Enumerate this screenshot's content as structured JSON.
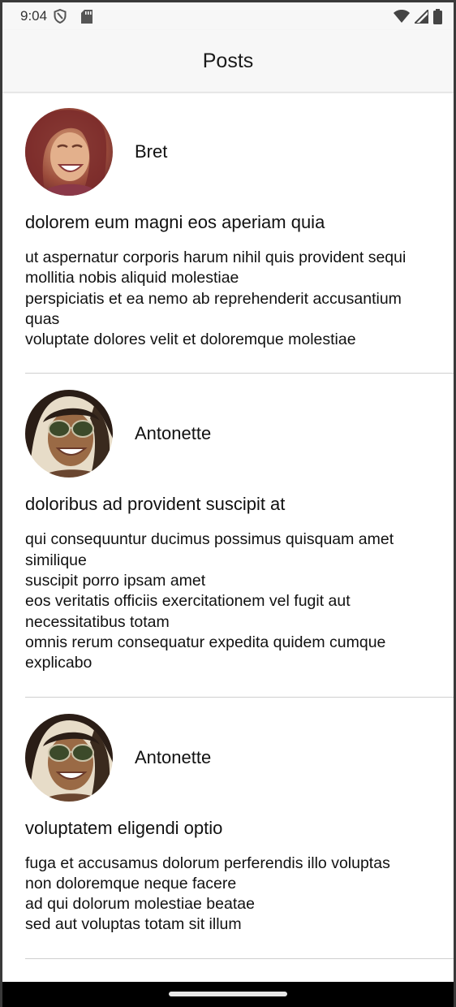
{
  "status_bar": {
    "time": "9:04",
    "icons": [
      "shield-icon",
      "sd-card-icon",
      "wifi-icon",
      "signal-icon",
      "battery-icon"
    ]
  },
  "app_bar": {
    "title": "Posts"
  },
  "posts": [
    {
      "author": "Bret",
      "avatar": "avatar-woman-laughing",
      "title": "dolorem eum magni eos aperiam quia",
      "body": "ut aspernatur corporis harum nihil quis provident sequi\nmollitia nobis aliquid molestiae\nperspiciatis et ea nemo ab reprehenderit accusantium quas\nvoluptate dolores velit et doloremque molestiae"
    },
    {
      "author": "Antonette",
      "avatar": "avatar-woman-sunglasses",
      "title": "doloribus ad provident suscipit at",
      "body": "qui consequuntur ducimus possimus quisquam amet similique\nsuscipit porro ipsam amet\neos veritatis officiis exercitationem vel fugit aut necessitatibus totam\nomnis rerum consequatur expedita quidem cumque explicabo"
    },
    {
      "author": "Antonette",
      "avatar": "avatar-woman-sunglasses",
      "title": "voluptatem eligendi optio",
      "body": "fuga et accusamus dolorum perferendis illo voluptas\nnon doloremque neque facere\nad qui dolorum molestiae beatae\nsed aut voluptas totam sit illum"
    }
  ],
  "colors": {
    "bar_background": "#f7f7f7",
    "divider": "#cfcfcf",
    "nav_bar": "#000000"
  }
}
